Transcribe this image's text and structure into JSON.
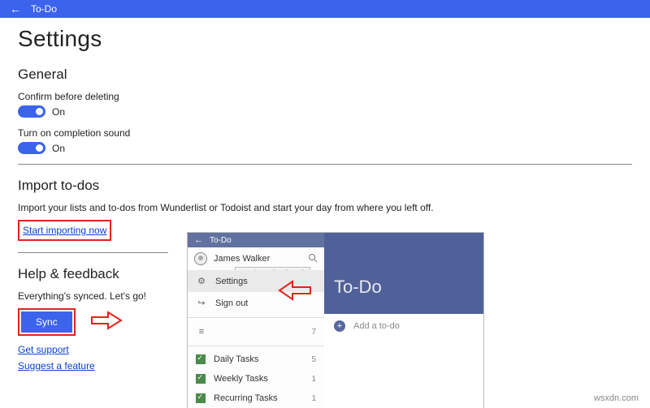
{
  "titlebar": {
    "app_name": "To-Do"
  },
  "page": {
    "title": "Settings"
  },
  "general": {
    "heading": "General",
    "confirm_delete": {
      "label": "Confirm before deleting",
      "state": "On"
    },
    "completion_sound": {
      "label": "Turn on completion sound",
      "state": "On"
    }
  },
  "import": {
    "heading": "Import to-dos",
    "desc": "Import your lists and to-dos from Wunderlist or Todoist and start your day from where you left off.",
    "link": "Start importing now"
  },
  "help": {
    "heading": "Help & feedback",
    "sync_status": "Everything's synced. Let's go!",
    "sync_button": "Sync",
    "get_support": "Get support",
    "suggest_feature": "Suggest a feature"
  },
  "sub": {
    "titlebar": "To-Do",
    "account": "James Walker",
    "tooltip": "Settings (Ctrl + P)",
    "menu": {
      "settings": "Settings",
      "signout": "Sign out"
    },
    "hamburger_count": "7",
    "lists": [
      {
        "name": "Daily Tasks",
        "count": "5"
      },
      {
        "name": "Weekly Tasks",
        "count": "1"
      },
      {
        "name": "Recurring Tasks",
        "count": "1"
      }
    ],
    "main_title": "To-Do",
    "add_todo": "Add a to-do"
  },
  "watermark": "wsxdn.com"
}
